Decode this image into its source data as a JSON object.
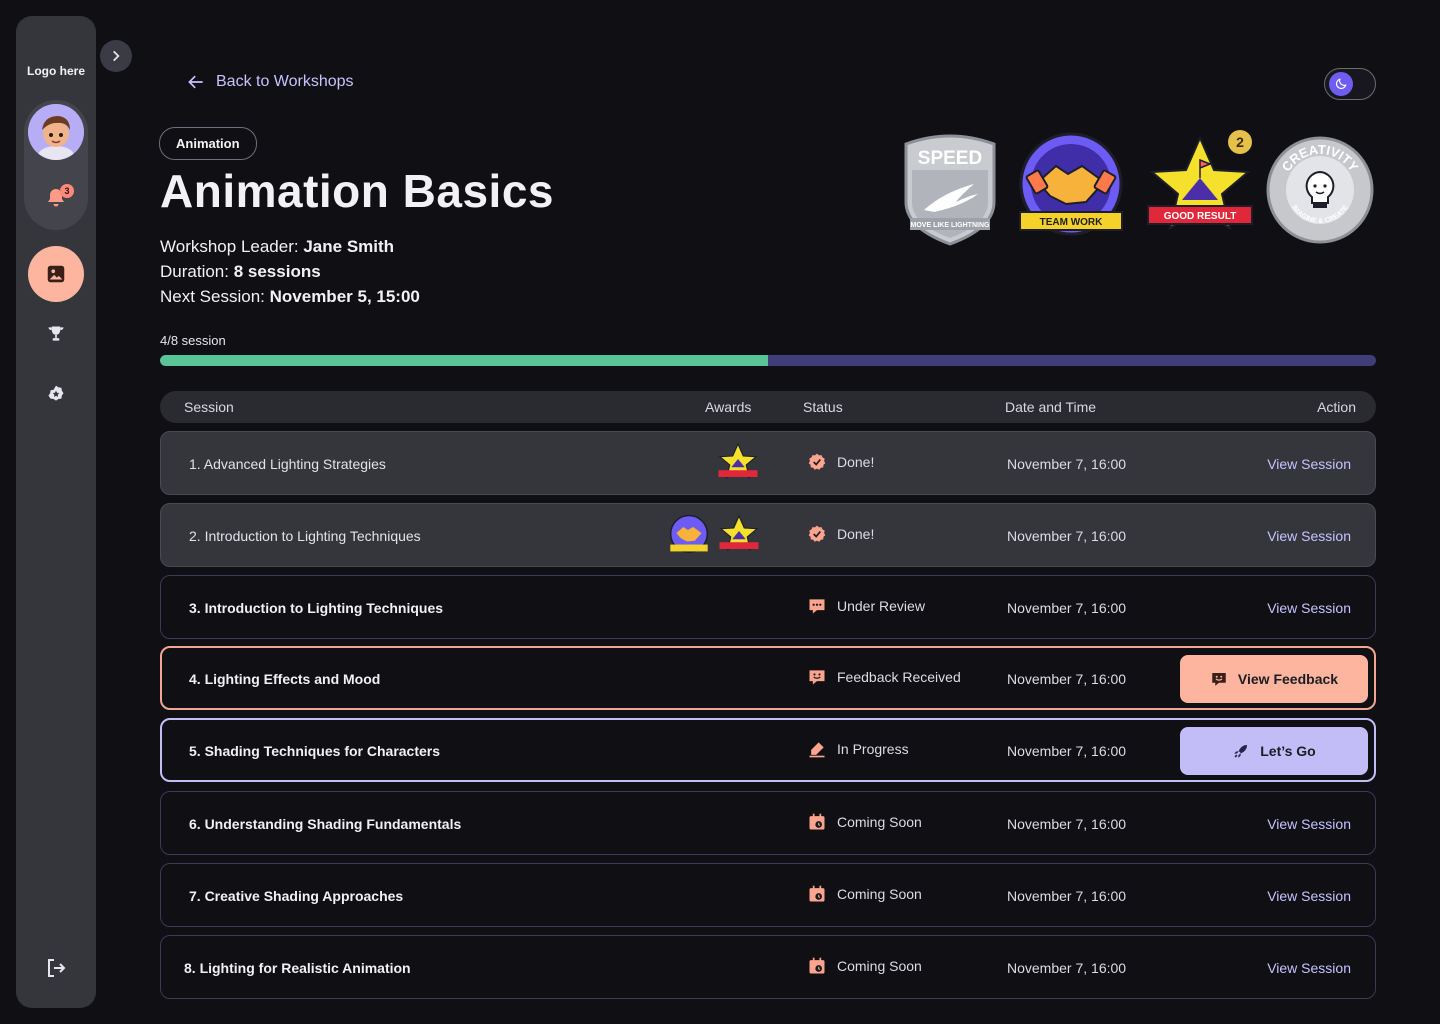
{
  "sidebar": {
    "logo": "Logo here",
    "notification_count": "3"
  },
  "header": {
    "back_label": "Back to Workshops",
    "tag": "Animation",
    "title": "Animation Basics",
    "leader_label": "Workshop Leader:",
    "leader": "Jane Smith",
    "duration_label": "Duration:",
    "duration": "8 sessions",
    "next_label": "Next Session:",
    "next": "November 5, 15:00"
  },
  "badges": [
    {
      "name": "SPEED",
      "ribbon": "MOVE LIKE LIGHTNING"
    },
    {
      "name": "TEAM WORK"
    },
    {
      "name": "GOOD RESULT",
      "count": "2"
    },
    {
      "name": "CREATIVITY",
      "ribbon": "IMAGINE & CREATE"
    }
  ],
  "progress": {
    "label": "4/8 session",
    "completed": 4,
    "total": 8
  },
  "table": {
    "headers": {
      "session": "Session",
      "awards": "Awards",
      "status": "Status",
      "date": "Date and Time",
      "action": "Action"
    },
    "rows": [
      {
        "name": "1. Advanced Lighting Strategies",
        "status": "Done!",
        "date": "November 7, 16:00",
        "action": "View Session"
      },
      {
        "name": "2. Introduction to Lighting Techniques",
        "status": "Done!",
        "date": "November 7, 16:00",
        "action": "View Session"
      },
      {
        "name": "3. Introduction to Lighting Techniques",
        "status": "Under Review",
        "date": "November 7, 16:00",
        "action": "View Session"
      },
      {
        "name": "4. Lighting Effects and Mood",
        "status": "Feedback Received",
        "date": "November 7, 16:00",
        "action": "View Feedback"
      },
      {
        "name": "5. Shading Techniques for Characters",
        "status": "In Progress",
        "date": "November 7, 16:00",
        "action": "Let’s Go"
      },
      {
        "name": "6. Understanding Shading Fundamentals",
        "status": "Coming Soon",
        "date": "November 7, 16:00",
        "action": "View Session"
      },
      {
        "name": "7. Creative Shading Approaches",
        "status": "Coming Soon",
        "date": "November 7, 16:00",
        "action": "View Session"
      },
      {
        "name": "8. Lighting for Realistic Animation",
        "status": "Coming Soon",
        "date": "November 7, 16:00",
        "action": "View Session"
      }
    ]
  },
  "colors": {
    "accent_peach": "#fdb59f",
    "accent_lavender": "#c3bdf7",
    "progress_fill": "#58c497",
    "progress_track": "#3f3e7a",
    "link": "#c7c3ff"
  },
  "icons": {
    "done": "check-badge-icon",
    "under_review": "chat-dots-icon",
    "feedback": "chat-smile-icon",
    "in_progress": "pencil-icon",
    "coming_soon": "calendar-clock-icon"
  }
}
